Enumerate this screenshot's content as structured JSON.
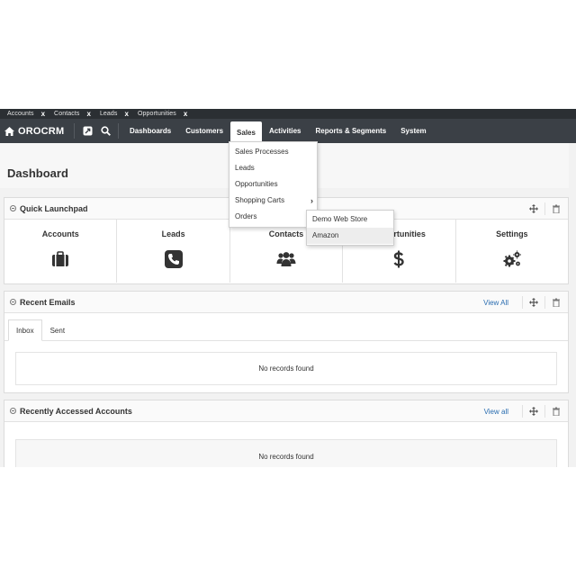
{
  "pinned_tabs": [
    {
      "label": "Accounts",
      "close": "x"
    },
    {
      "label": "Contacts",
      "close": "x"
    },
    {
      "label": "Leads",
      "close": "x"
    },
    {
      "label": "Opportunities",
      "close": "x"
    }
  ],
  "brand": {
    "name": "OROCRM"
  },
  "nav": {
    "items": [
      "Dashboards",
      "Customers",
      "Sales",
      "Activities",
      "Reports & Segments",
      "System"
    ],
    "active": "Sales"
  },
  "sales_menu": {
    "items": [
      "Sales Processes",
      "Leads",
      "Opportunities",
      "Shopping Carts",
      "Orders"
    ],
    "submenu_arrow": "›"
  },
  "shopping_carts_submenu": {
    "items": [
      "Demo Web Store",
      "Amazon"
    ],
    "hovered": "Amazon"
  },
  "page": {
    "title": "Dashboard"
  },
  "quick_launchpad": {
    "title": "Quick Launchpad",
    "items": [
      {
        "label": "Accounts",
        "icon": "briefcase-icon"
      },
      {
        "label": "Leads",
        "icon": "phone-icon"
      },
      {
        "label": "Contacts",
        "icon": "users-icon"
      },
      {
        "label": "Opportunities",
        "icon": "dollar-icon"
      },
      {
        "label": "Settings",
        "icon": "gears-icon"
      }
    ]
  },
  "recent_emails": {
    "title": "Recent Emails",
    "view_all": "View All",
    "tabs": [
      "Inbox",
      "Sent"
    ],
    "active_tab": "Inbox",
    "empty_text": "No records found"
  },
  "recent_accounts": {
    "title": "Recently Accessed Accounts",
    "view_all": "View all",
    "empty_text": "No records found"
  },
  "colors": {
    "nav_bg": "#3b4046",
    "pinbar_bg": "#2b2f33",
    "link": "#2a6db0",
    "page_bg": "#f2f2f2"
  }
}
